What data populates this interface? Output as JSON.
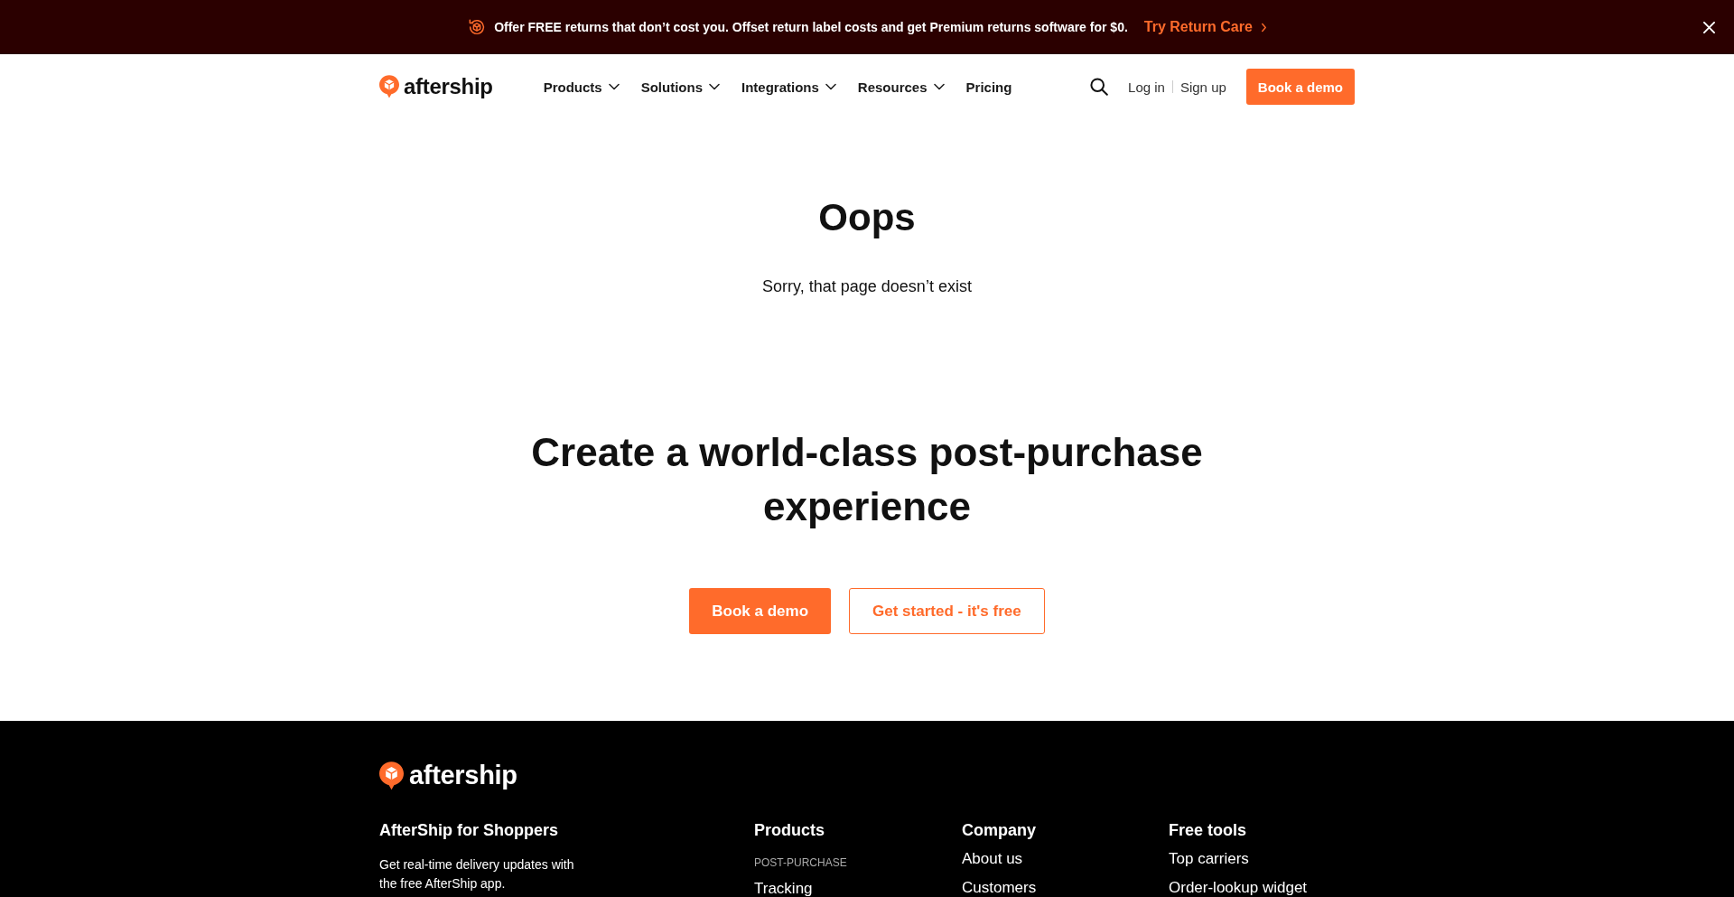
{
  "announcement": {
    "text": "Offer FREE returns that don’t cost you. Offset return label costs and get Premium returns software for $0.",
    "link": "Try Return Care"
  },
  "header": {
    "logo": "aftership",
    "nav": [
      {
        "label": "Products",
        "kind": "dropdown"
      },
      {
        "label": "Solutions",
        "kind": "dropdown"
      },
      {
        "label": "Integrations",
        "kind": "dropdown"
      },
      {
        "label": "Resources",
        "kind": "dropdown"
      },
      {
        "label": "Pricing",
        "kind": "link"
      }
    ],
    "login": "Log in",
    "signup": "Sign up",
    "cta": "Book a demo"
  },
  "error": {
    "title": "Oops",
    "message": "Sorry, that page doesn’t exist"
  },
  "cta_section": {
    "heading": "Create a world-class post-purchase experience",
    "buttons": [
      {
        "label": "Book a demo",
        "kind": "primary"
      },
      {
        "label": "Get started - it's free",
        "kind": "outline"
      }
    ]
  },
  "footer": {
    "logo": "aftership",
    "columns": [
      {
        "title": "AfterShip for Shoppers",
        "items": [
          {
            "kind": "text",
            "text": "Get real-time delivery updates with the free AfterShip app."
          }
        ]
      },
      {
        "title": "Products",
        "items": [
          {
            "kind": "label",
            "text": "POST-PURCHASE"
          },
          {
            "kind": "link",
            "text": "Tracking"
          }
        ]
      },
      {
        "title": "Company",
        "items": [
          {
            "kind": "link",
            "text": "About us"
          },
          {
            "kind": "link",
            "text": "Customers"
          }
        ]
      },
      {
        "title": "Free tools",
        "items": [
          {
            "kind": "link",
            "text": "Top carriers"
          },
          {
            "kind": "link",
            "text": "Order-lookup widget"
          }
        ]
      }
    ]
  }
}
